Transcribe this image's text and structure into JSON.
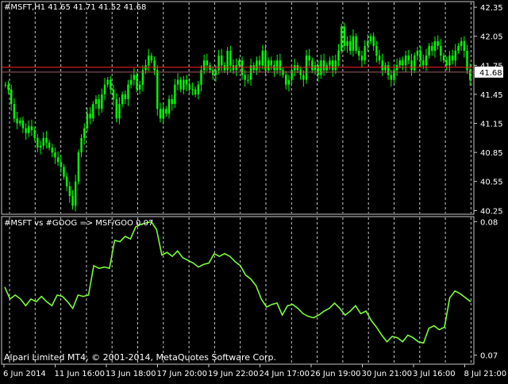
{
  "window": {
    "main_title": "#MSFT,H1  41.65 41.71 41.52 41.68",
    "indicator_title": "#MSFT vs #GOOG => MSF/GOO 0.07",
    "copyright": "Alpari Limited MT4, © 2001-2014, MetaQuotes Software Corp."
  },
  "colors": {
    "background": "#000000",
    "candles": "#00ff00",
    "indicator_line": "#7cfc3a",
    "grid": "#c8c8c8",
    "frame": "#c8c8c8",
    "text": "#ffffff",
    "price_line": "#ff2020",
    "bid_line": "#a06060",
    "price_tag_bg": "#ffffff",
    "price_tag_text": "#000000"
  },
  "chart_data": [
    {
      "type": "candlestick",
      "symbol": "#MSFT",
      "timeframe": "H1",
      "title": "#MSFT,H1  41.65 41.71 41.52 41.68",
      "ohlc": {
        "open": 41.65,
        "high": 41.71,
        "low": 41.52,
        "close": 41.68
      },
      "current_price": "41.68",
      "current_price_value": 41.68,
      "price_line_value": 41.73,
      "ylim": [
        40.22,
        42.4
      ],
      "yticks": [
        "42.35",
        "42.05",
        "41.75",
        "41.45",
        "41.15",
        "40.85",
        "40.55",
        "40.25"
      ],
      "ytick_values": [
        42.35,
        42.05,
        41.75,
        41.45,
        41.15,
        40.85,
        40.55,
        40.25
      ],
      "xticks": [
        "6 Jun 2014",
        "11 Jun 16:00",
        "13 Jun 18:00",
        "17 Jun 20:00",
        "19 Jun 22:00",
        "24 Jun 17:00",
        "26 Jun 19:00",
        "30 Jun 21:00",
        "3 Jul 16:00",
        "8 Jul 21:00"
      ],
      "grid": "vertical-dashed",
      "close_series": [
        41.55,
        41.5,
        41.35,
        41.2,
        41.15,
        41.18,
        41.1,
        41.05,
        41.12,
        41.08,
        41.0,
        40.9,
        40.92,
        41.0,
        40.95,
        40.9,
        40.85,
        40.8,
        40.75,
        40.7,
        40.6,
        40.5,
        40.4,
        40.3,
        40.55,
        40.85,
        41.0,
        41.1,
        41.25,
        41.2,
        41.35,
        41.4,
        41.3,
        41.45,
        41.55,
        41.6,
        41.5,
        41.4,
        41.2,
        41.35,
        41.45,
        41.4,
        41.55,
        41.6,
        41.65,
        41.5,
        41.55,
        41.7,
        41.75,
        41.85,
        41.8,
        41.7,
        41.3,
        41.2,
        41.3,
        41.25,
        41.4,
        41.35,
        41.55,
        41.6,
        41.5,
        41.6,
        41.55,
        41.5,
        41.5,
        41.45,
        41.55,
        41.7,
        41.8,
        41.75,
        41.7,
        41.65,
        41.7,
        41.85,
        41.75,
        41.7,
        41.9,
        41.75,
        41.7,
        41.75,
        41.8,
        41.65,
        41.6,
        41.6,
        41.75,
        41.7,
        41.8,
        41.75,
        41.9,
        41.7,
        41.8,
        41.75,
        41.7,
        41.8,
        41.7,
        41.65,
        41.55,
        41.6,
        41.7,
        41.75,
        41.7,
        41.65,
        41.6,
        41.85,
        41.8,
        41.7,
        41.75,
        41.65,
        41.8,
        41.7,
        41.75,
        41.8,
        41.7,
        41.8,
        41.9,
        42.15,
        41.95,
        42.0,
        41.9,
        42.05,
        41.9,
        41.85,
        41.8,
        41.95,
        42.0,
        42.05,
        41.95,
        41.85,
        41.8,
        41.7,
        41.75,
        41.65,
        41.6,
        41.7,
        41.75,
        41.8,
        41.75,
        41.85,
        41.8,
        41.7,
        41.85,
        41.9,
        41.8,
        41.75,
        41.85,
        41.95,
        41.9,
        42.0,
        41.95,
        41.85,
        41.8,
        41.75,
        41.85,
        41.8,
        41.9,
        41.95,
        42.0,
        41.9,
        41.7,
        41.6
      ]
    },
    {
      "type": "line",
      "title": "#MSFT vs #GOOG => MSF/GOO 0.07",
      "ylim": [
        0.0695,
        0.0802
      ],
      "yticks": [
        "0.08",
        "0.07"
      ],
      "ytick_values": [
        0.08,
        0.07
      ],
      "values": [
        0.0751,
        0.0742,
        0.0745,
        0.0742,
        0.0737,
        0.0742,
        0.074,
        0.0744,
        0.074,
        0.0737,
        0.0745,
        0.0744,
        0.074,
        0.0735,
        0.0745,
        0.0744,
        0.0745,
        0.0767,
        0.0765,
        0.0766,
        0.0765,
        0.0786,
        0.0785,
        0.0789,
        0.0787,
        0.0796,
        0.0798,
        0.0799,
        0.08,
        0.0794,
        0.0775,
        0.0777,
        0.0774,
        0.0778,
        0.0773,
        0.0771,
        0.0769,
        0.0766,
        0.0768,
        0.0769,
        0.0776,
        0.0774,
        0.0776,
        0.0774,
        0.077,
        0.0767,
        0.076,
        0.0757,
        0.0752,
        0.0742,
        0.0736,
        0.0738,
        0.0739,
        0.073,
        0.0737,
        0.0738,
        0.0735,
        0.0731,
        0.0729,
        0.0728,
        0.073,
        0.0733,
        0.0735,
        0.0739,
        0.0735,
        0.073,
        0.0733,
        0.0737,
        0.0731,
        0.0733,
        0.0726,
        0.0721,
        0.0715,
        0.071,
        0.0714,
        0.0713,
        0.071,
        0.0715,
        0.0713,
        0.071,
        0.0709,
        0.072,
        0.0722,
        0.0719,
        0.0721,
        0.0743,
        0.0748,
        0.0746,
        0.0743,
        0.074
      ]
    }
  ]
}
